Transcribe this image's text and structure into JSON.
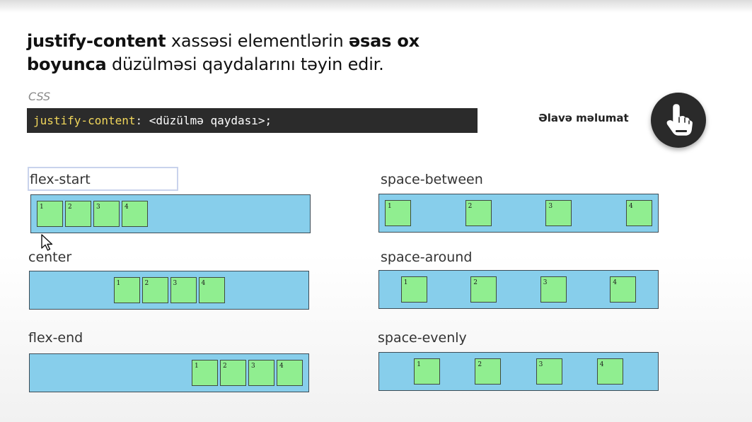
{
  "heading": {
    "part1_bold": "justify-content",
    "part2": " xassəsi elementlərin ",
    "part3_bold": "əsas ox",
    "part4_bold": "boyunca",
    "part5": " düzülməsi qaydalarını təyin edir."
  },
  "code": {
    "label": "CSS",
    "property": "justify-content",
    "colon": ":",
    "value": " <düzülmə qaydası>;"
  },
  "more": {
    "label": "Əlavə məlumat",
    "icon": "pointing-hand-icon"
  },
  "demos": [
    {
      "label": "flex-start",
      "items": [
        "1",
        "2",
        "3",
        "4"
      ]
    },
    {
      "label": "center",
      "items": [
        "1",
        "2",
        "3",
        "4"
      ]
    },
    {
      "label": "flex-end",
      "items": [
        "1",
        "2",
        "3",
        "4"
      ]
    },
    {
      "label": "space-between",
      "items": [
        "1",
        "2",
        "3",
        "4"
      ]
    },
    {
      "label": "space-around",
      "items": [
        "1",
        "2",
        "3",
        "4"
      ]
    },
    {
      "label": "space-evenly",
      "items": [
        "1",
        "2",
        "3",
        "4"
      ]
    }
  ],
  "colors": {
    "container": "#87ceeb",
    "item": "#90ee90",
    "code_background": "#2b2b2b",
    "code_property": "#f2d75b"
  }
}
